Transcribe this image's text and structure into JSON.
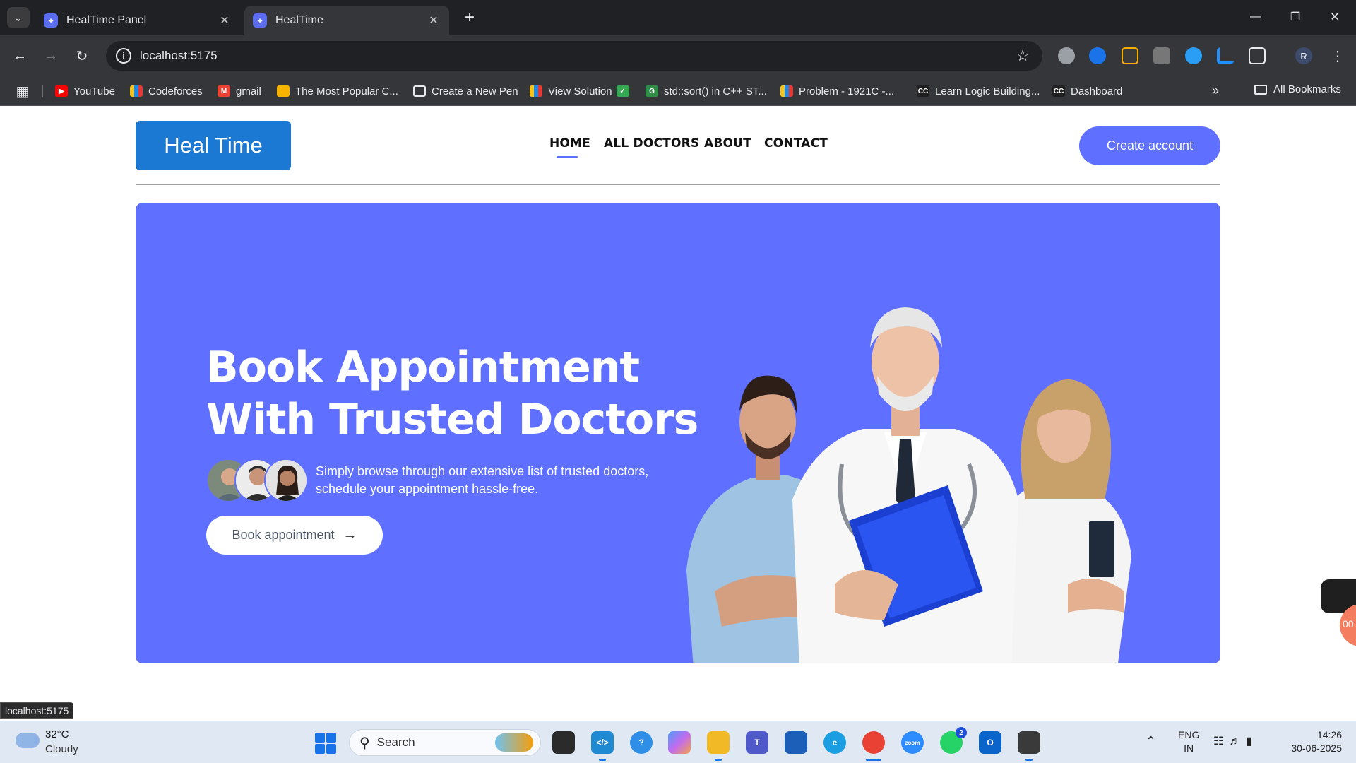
{
  "browser": {
    "tabs": [
      {
        "title": "HealTime Panel"
      },
      {
        "title": "HealTime"
      }
    ],
    "address": "localhost:5175",
    "bookmarks": [
      {
        "label": "YouTube"
      },
      {
        "label": "Codeforces"
      },
      {
        "label": "gmail"
      },
      {
        "label": "The Most Popular C..."
      },
      {
        "label": "Create a New Pen"
      },
      {
        "label": "View Solution"
      },
      {
        "label": "std::sort() in C++ ST..."
      },
      {
        "label": "Problem - 1921C -..."
      },
      {
        "label": "Learn Logic Building..."
      },
      {
        "label": "Dashboard"
      }
    ],
    "all_bookmarks": "All Bookmarks",
    "profile_initial": "R",
    "status_url": "localhost:5175"
  },
  "site": {
    "logo": "Heal Time",
    "nav": [
      {
        "label": "HOME",
        "active": true
      },
      {
        "label": "ALL DOCTORS"
      },
      {
        "label": "ABOUT"
      },
      {
        "label": "CONTACT"
      }
    ],
    "create_account": "Create account",
    "hero": {
      "title_line1": "Book Appointment",
      "title_line2": "With Trusted Doctors",
      "desc_line1": "Simply browse through our extensive list of trusted doctors,",
      "desc_line2": "schedule your appointment hassle-free.",
      "button": "Book appointment",
      "arrow": "→"
    },
    "float_badge": "00"
  },
  "taskbar": {
    "weather_temp": "32°C",
    "weather_cond": "Cloudy",
    "search": "Search",
    "lang_top": "ENG",
    "lang_bottom": "IN",
    "time": "14:26",
    "date": "30-06-2025",
    "whatsapp_badge": "2"
  },
  "colors": {
    "brand": "#5f6fff",
    "logo_bg": "#1b78d3"
  }
}
